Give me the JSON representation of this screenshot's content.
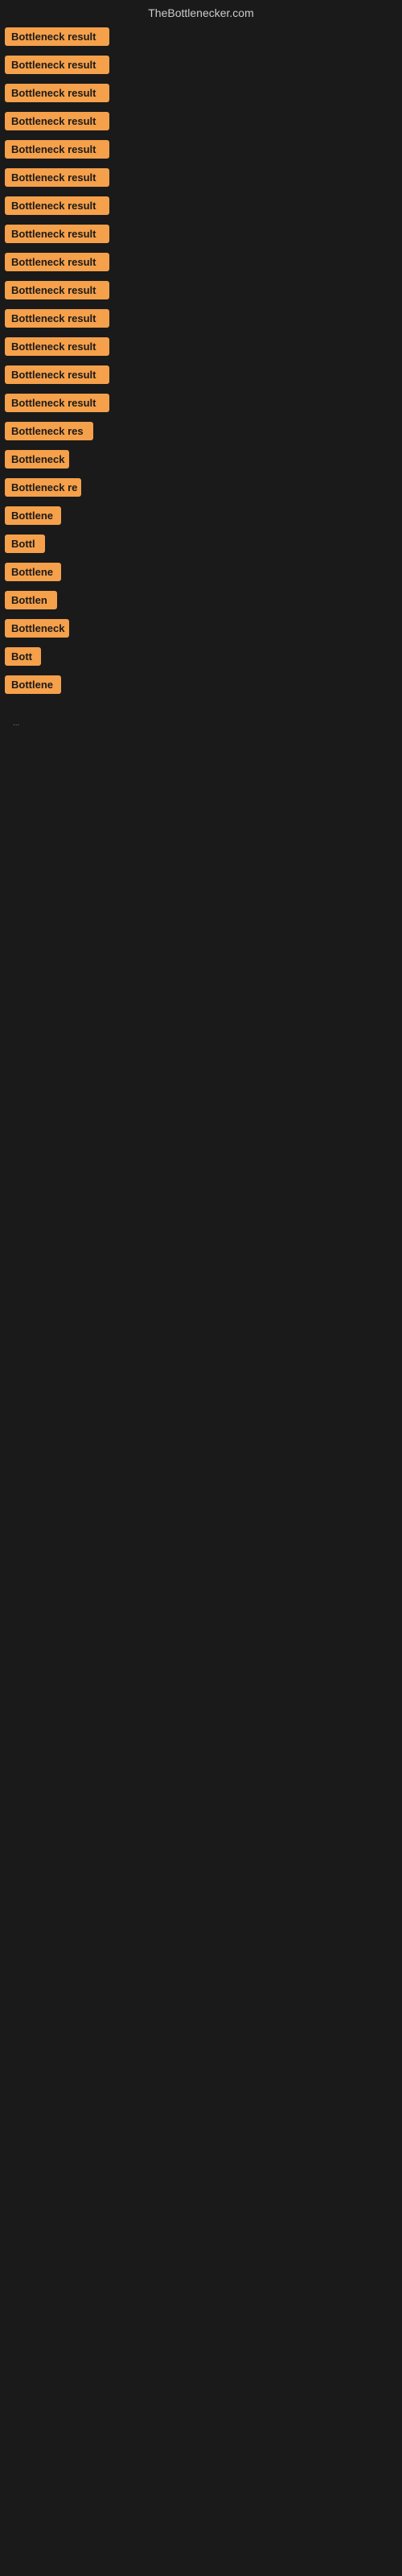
{
  "header": {
    "title": "TheBottlenecker.com"
  },
  "accent_color": "#f5a04a",
  "results": [
    {
      "id": 1,
      "label": "Bottleneck result",
      "width": 130
    },
    {
      "id": 2,
      "label": "Bottleneck result",
      "width": 130
    },
    {
      "id": 3,
      "label": "Bottleneck result",
      "width": 130
    },
    {
      "id": 4,
      "label": "Bottleneck result",
      "width": 130
    },
    {
      "id": 5,
      "label": "Bottleneck result",
      "width": 130
    },
    {
      "id": 6,
      "label": "Bottleneck result",
      "width": 130
    },
    {
      "id": 7,
      "label": "Bottleneck result",
      "width": 130
    },
    {
      "id": 8,
      "label": "Bottleneck result",
      "width": 130
    },
    {
      "id": 9,
      "label": "Bottleneck result",
      "width": 130
    },
    {
      "id": 10,
      "label": "Bottleneck result",
      "width": 130
    },
    {
      "id": 11,
      "label": "Bottleneck result",
      "width": 130
    },
    {
      "id": 12,
      "label": "Bottleneck result",
      "width": 130
    },
    {
      "id": 13,
      "label": "Bottleneck result",
      "width": 130
    },
    {
      "id": 14,
      "label": "Bottleneck result",
      "width": 130
    },
    {
      "id": 15,
      "label": "Bottleneck res",
      "width": 110
    },
    {
      "id": 16,
      "label": "Bottleneck",
      "width": 80
    },
    {
      "id": 17,
      "label": "Bottleneck re",
      "width": 95
    },
    {
      "id": 18,
      "label": "Bottlene",
      "width": 70
    },
    {
      "id": 19,
      "label": "Bottl",
      "width": 50
    },
    {
      "id": 20,
      "label": "Bottlene",
      "width": 70
    },
    {
      "id": 21,
      "label": "Bottlen",
      "width": 65
    },
    {
      "id": 22,
      "label": "Bottleneck",
      "width": 80
    },
    {
      "id": 23,
      "label": "Bott",
      "width": 45
    },
    {
      "id": 24,
      "label": "Bottlene",
      "width": 70
    }
  ],
  "ellipsis": "..."
}
